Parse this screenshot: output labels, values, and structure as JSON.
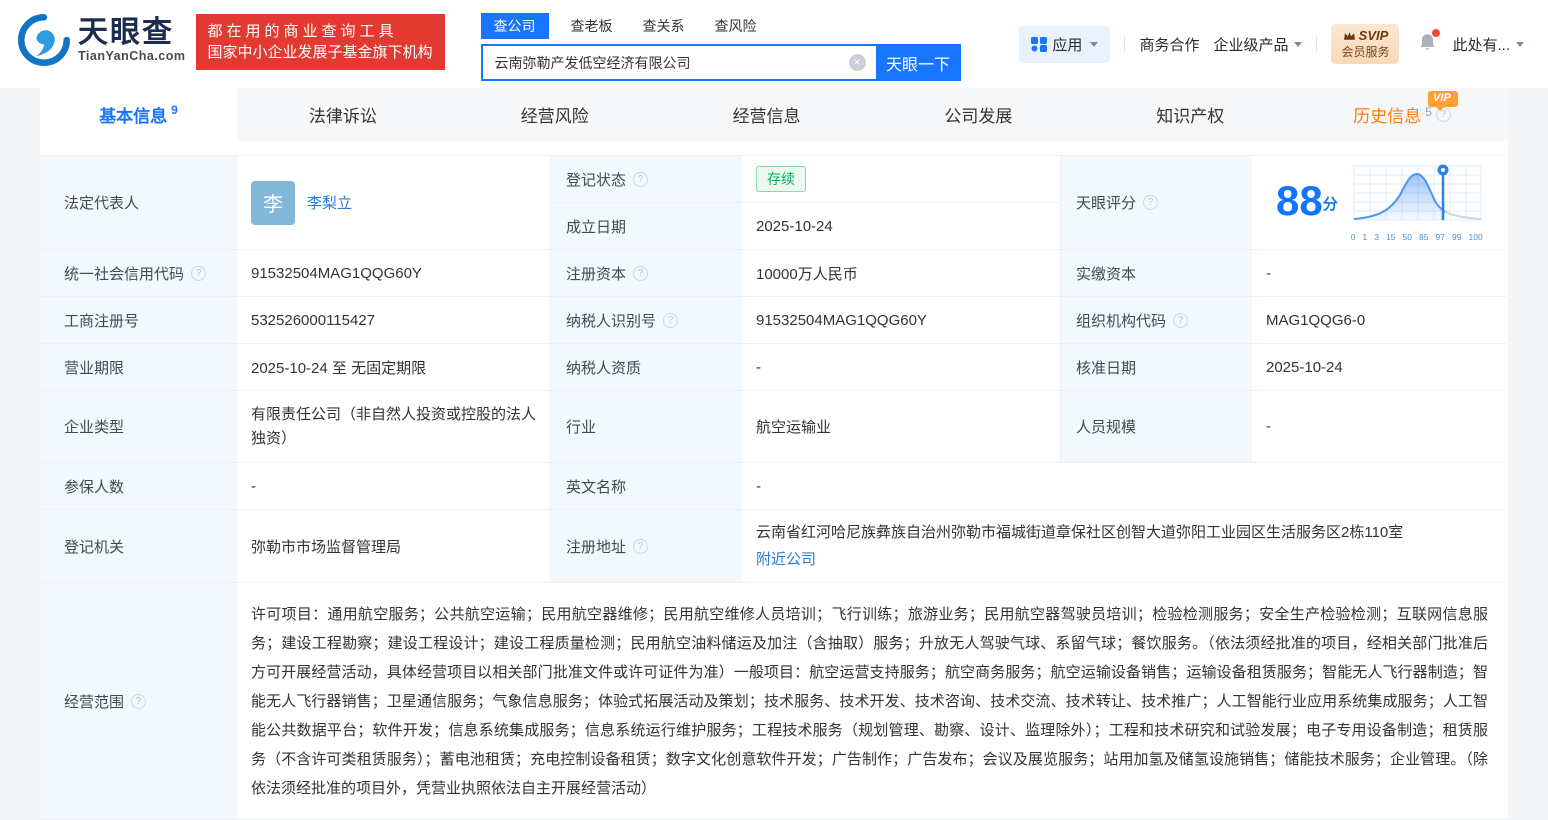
{
  "icons": {
    "question": "?",
    "clear": "×"
  },
  "brand": {
    "logo_title": "天眼查",
    "logo_domain": "TianYanCha.com",
    "slogan_line1": "都在用的商业查询工具",
    "slogan_line2": "国家中小企业发展子基金旗下机构"
  },
  "search": {
    "tabs": [
      {
        "key": "company",
        "label": "查公司",
        "active": true
      },
      {
        "key": "boss",
        "label": "查老板",
        "active": false
      },
      {
        "key": "relation",
        "label": "查关系",
        "active": false
      },
      {
        "key": "risk",
        "label": "查风险",
        "active": false
      }
    ],
    "value": "云南弥勒产发低空经济有限公司",
    "button": "天眼一下"
  },
  "topnav": {
    "apps": "应用",
    "biz": "商务合作",
    "enterprise": "企业级产品",
    "vip_line1": "SVIP",
    "vip_line2": "会员服务",
    "more": "此处有..."
  },
  "tabs": [
    {
      "key": "basic",
      "label": "基本信息",
      "count": "9",
      "active": true
    },
    {
      "key": "lawsuit",
      "label": "法律诉讼"
    },
    {
      "key": "operating-risk",
      "label": "经营风险"
    },
    {
      "key": "operating-info",
      "label": "经营信息"
    },
    {
      "key": "development",
      "label": "公司发展"
    },
    {
      "key": "intellectual-property",
      "label": "知识产权"
    },
    {
      "key": "history",
      "label": "历史信息",
      "count": "5",
      "vip": "VIP",
      "question": true
    }
  ],
  "info": {
    "legal_rep_label": "法定代表人",
    "legal_rep_avatar": "李",
    "legal_rep_name": "李梨立",
    "reg_status_label": "登记状态",
    "reg_status": "存续",
    "establish_date_label": "成立日期",
    "establish_date": "2025-10-24",
    "score_label": "天眼评分",
    "score": "88",
    "score_unit": "分",
    "score_ticks": [
      "0",
      "1",
      "3",
      "15",
      "50",
      "85",
      "97",
      "99",
      "100"
    ],
    "uscc_label": "统一社会信用代码",
    "uscc": "91532504MAG1QQG60Y",
    "reg_capital_label": "注册资本",
    "reg_capital": "10000万人民币",
    "paid_capital_label": "实缴资本",
    "paid_capital": "-",
    "reg_number_label": "工商注册号",
    "reg_number": "532526000115427",
    "taxpayer_id_label": "纳税人识别号",
    "taxpayer_id": "91532504MAG1QQG60Y",
    "org_code_label": "组织机构代码",
    "org_code": "MAG1QQG6-0",
    "business_term_label": "营业期限",
    "business_term": "2025-10-24 至 无固定期限",
    "taxpayer_quality_label": "纳税人资质",
    "taxpayer_quality": "-",
    "approval_date_label": "核准日期",
    "approval_date": "2025-10-24",
    "company_type_label": "企业类型",
    "company_type": "有限责任公司（非自然人投资或控股的法人独资）",
    "industry_label": "行业",
    "industry": "航空运输业",
    "staff_size_label": "人员规模",
    "staff_size": "-",
    "insured_label": "参保人数",
    "insured": "-",
    "english_name_label": "英文名称",
    "english_name": "-",
    "reg_authority_label": "登记机关",
    "reg_authority": "弥勒市市场监督管理局",
    "reg_address_label": "注册地址",
    "reg_address": "云南省红河哈尼族彝族自治州弥勒市福城街道章保社区创智大道弥阳工业园区生活服务区2栋110室",
    "nearby_link": "附近公司",
    "business_scope_label": "经营范围",
    "business_scope": "许可项目：通用航空服务；公共航空运输；民用航空器维修；民用航空维修人员培训；飞行训练；旅游业务；民用航空器驾驶员培训；检验检测服务；安全生产检验检测；互联网信息服务；建设工程勘察；建设工程设计；建设工程质量检测；民用航空油料储运及加注（含抽取）服务；升放无人驾驶气球、系留气球；餐饮服务。（依法须经批准的项目，经相关部门批准后方可开展经营活动，具体经营项目以相关部门批准文件或许可证件为准）一般项目：航空运营支持服务；航空商务服务；航空运输设备销售；运输设备租赁服务；智能无人飞行器制造；智能无人飞行器销售；卫星通信服务；气象信息服务；体验式拓展活动及策划；技术服务、技术开发、技术咨询、技术交流、技术转让、技术推广；人工智能行业应用系统集成服务；人工智能公共数据平台；软件开发；信息系统集成服务；信息系统运行维护服务；工程技术服务（规划管理、勘察、设计、监理除外）；工程和技术研究和试验发展；电子专用设备制造；租赁服务（不含许可类租赁服务）；蓄电池租赁；充电控制设备租赁；数字文化创意软件开发；广告制作；广告发布；会议及展览服务；站用加氢及储氢设施销售；储能技术服务；企业管理。（除依法须经批准的项目外，凭营业执照依法自主开展经营活动）"
  },
  "colors": {
    "brand_blue": "#1775ff",
    "link_blue": "#2b7bd3",
    "slogan_red": "#e23a30",
    "status_green": "#00b15c",
    "history_orange": "#ff7d00",
    "label_bg": "#f2f8fc"
  }
}
